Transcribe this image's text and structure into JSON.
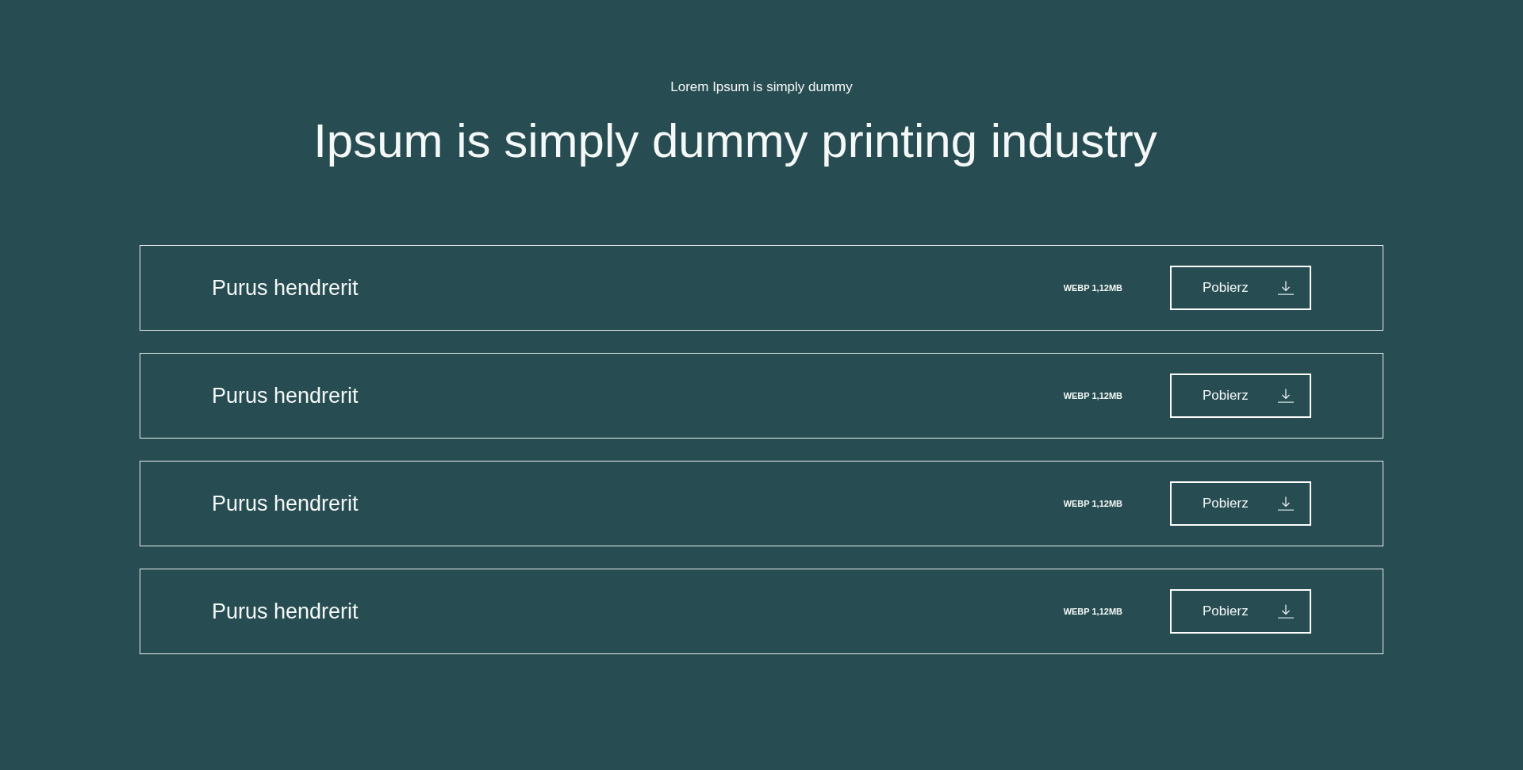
{
  "header": {
    "eyebrow": "Lorem Ipsum is simply dummy",
    "title": "Ipsum is simply dummy printing industry"
  },
  "files": [
    {
      "name": "Purus hendrerit",
      "info": "WEBP 1,12MB",
      "button": "Pobierz"
    },
    {
      "name": "Purus hendrerit",
      "info": "WEBP 1,12MB",
      "button": "Pobierz"
    },
    {
      "name": "Purus hendrerit",
      "info": "WEBP 1,12MB",
      "button": "Pobierz"
    },
    {
      "name": "Purus hendrerit",
      "info": "WEBP 1,12MB",
      "button": "Pobierz"
    }
  ]
}
